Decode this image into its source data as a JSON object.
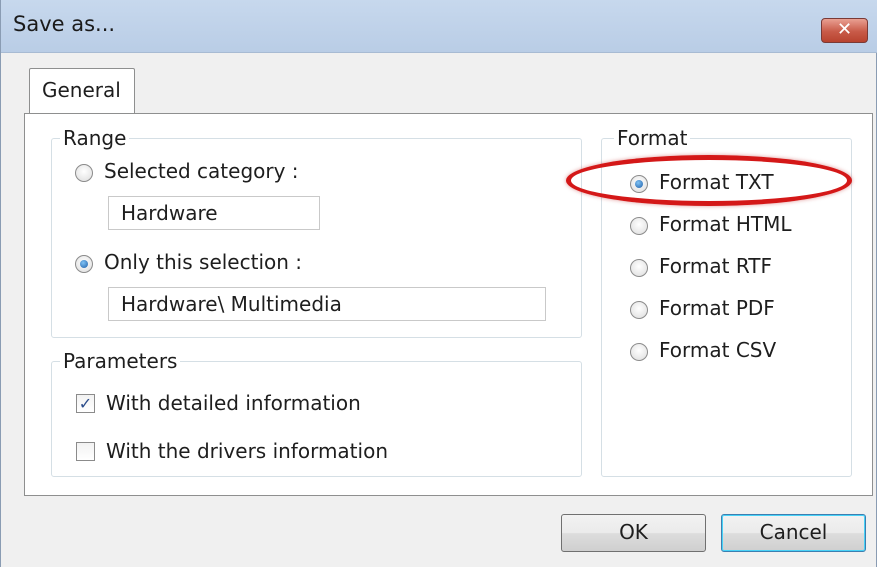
{
  "window": {
    "title": "Save as...",
    "close_symbol": "✕"
  },
  "tabs": [
    {
      "label": "General",
      "selected": true
    }
  ],
  "range": {
    "legend": "Range",
    "selected_category": {
      "label": "Selected category :",
      "checked": false,
      "value": "Hardware"
    },
    "only_this_selection": {
      "label": "Only this selection :",
      "checked": true,
      "value": "Hardware\\ Multimedia"
    }
  },
  "parameters": {
    "legend": "Parameters",
    "detailed_info": {
      "label": "With detailed information",
      "checked": true,
      "check_glyph": "✓"
    },
    "drivers_info": {
      "label": "With the drivers information",
      "checked": false,
      "check_glyph": ""
    }
  },
  "format": {
    "legend": "Format",
    "options": [
      {
        "label": "Format TXT",
        "checked": true
      },
      {
        "label": "Format HTML",
        "checked": false
      },
      {
        "label": "Format RTF",
        "checked": false
      },
      {
        "label": "Format PDF",
        "checked": false
      },
      {
        "label": "Format CSV",
        "checked": false
      }
    ]
  },
  "buttons": {
    "ok": "OK",
    "cancel": "Cancel"
  },
  "colors": {
    "highlight": "#d41818",
    "close_button": "#c85a48",
    "title_bar": "#c7d8ed"
  }
}
